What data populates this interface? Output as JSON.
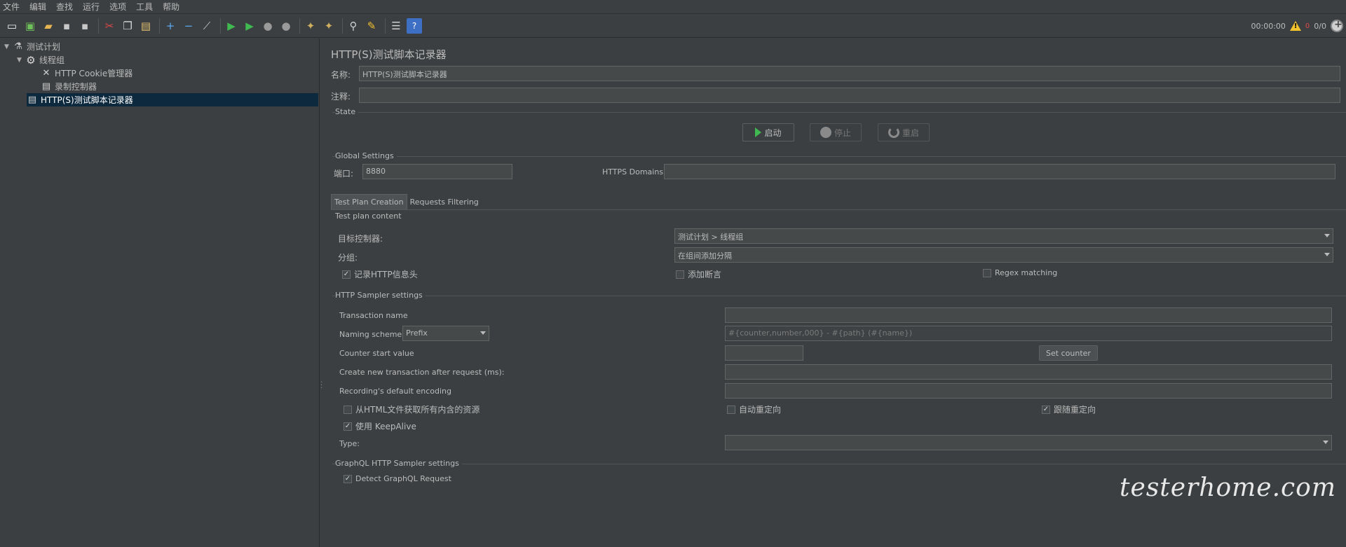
{
  "menu": [
    "文件",
    "编辑",
    "查找",
    "运行",
    "选项",
    "工具",
    "帮助"
  ],
  "toolbar": {
    "icons": [
      "new-icon",
      "templates-icon",
      "open-icon",
      "save-icon",
      "save-as-icon",
      "cut-icon",
      "copy-icon",
      "paste-icon",
      "expand-icon",
      "collapse-icon",
      "toggle-icon",
      "start-icon",
      "start-no-pause-icon",
      "stop-icon",
      "shutdown-icon",
      "clear-icon",
      "clear-all-icon",
      "search-icon",
      "reset-search-icon",
      "function-helper-icon",
      "help-icon"
    ],
    "timer": "00:00:00",
    "error_count": "0",
    "ratio": "0/0"
  },
  "tree": {
    "items": [
      {
        "label": "测试计划",
        "icon": "test-plan-icon",
        "level": 0,
        "expanded": true
      },
      {
        "label": "线程组",
        "icon": "thread-group-icon",
        "level": 1,
        "expanded": true
      },
      {
        "label": "HTTP Cookie管理器",
        "icon": "cookie-manager-icon",
        "level": 2
      },
      {
        "label": "录制控制器",
        "icon": "recording-controller-icon",
        "level": 2
      },
      {
        "label": "HTTP(S)测试脚本记录器",
        "icon": "recorder-icon",
        "level": 1,
        "selected": true
      }
    ]
  },
  "panel": {
    "title": "HTTP(S)测试脚本记录器",
    "name_label": "名称:",
    "name_value": "HTTP(S)测试脚本记录器",
    "comment_label": "注释:",
    "comment_value": "",
    "state": {
      "title": "State",
      "start": "启动",
      "stop": "停止",
      "restart": "重启"
    },
    "global": {
      "title": "Global Settings",
      "port_label": "端口:",
      "port_value": "8880",
      "https_label": "HTTPS Domains:",
      "https_value": ""
    },
    "tabs": [
      "Test Plan Creation",
      "Requests Filtering"
    ],
    "plan_content": {
      "title": "Test plan content",
      "target_label": "目标控制器:",
      "target_value": "测试计划 > 线程组",
      "grouping_label": "分组:",
      "grouping_value": "在组间添加分隔",
      "record_headers": "记录HTTP信息头",
      "add_assertions": "添加断言",
      "regex_matching": "Regex matching"
    },
    "sampler": {
      "title": "HTTP Sampler settings",
      "transaction_label": "Transaction name",
      "transaction_value": "",
      "naming_label": "Naming scheme",
      "naming_value": "Prefix",
      "naming_format_placeholder": "#{counter,number,000} - #{path} (#{name})",
      "counter_label": "Counter start value",
      "counter_value": "",
      "set_counter": "Set counter",
      "new_transaction_label": "Create new transaction after request (ms):",
      "new_transaction_value": "",
      "encoding_label": "Recording's default encoding",
      "encoding_value": "",
      "retrieve_resources": "从HTML文件获取所有内含的资源",
      "auto_redirect": "自动重定向",
      "follow_redirects": "跟随重定向",
      "keepalive": "使用 KeepAlive",
      "type_label": "Type:",
      "type_value": ""
    },
    "graphql": {
      "title": "GraphQL HTTP Sampler settings",
      "detect": "Detect GraphQL Request"
    }
  },
  "watermark": "testerhome.com"
}
